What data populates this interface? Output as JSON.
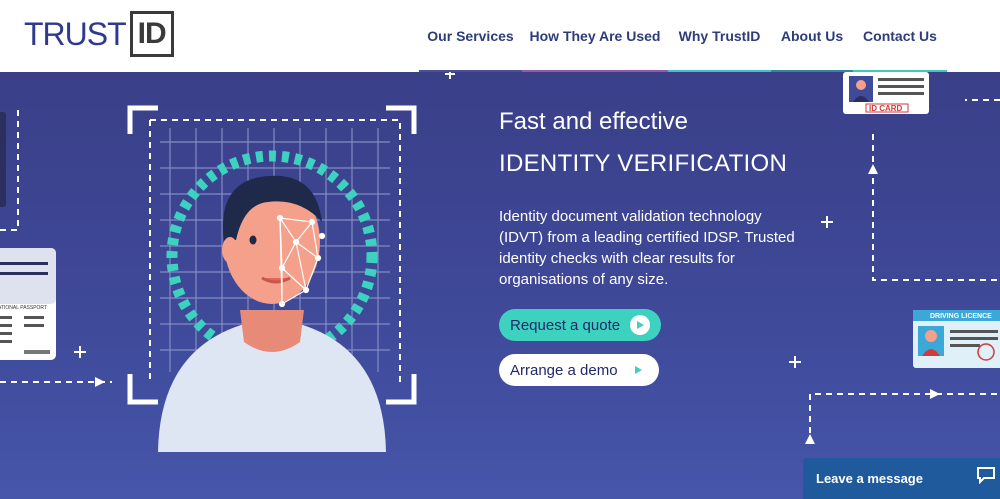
{
  "logo": {
    "trust": "TRUST",
    "id": "ID"
  },
  "nav": [
    {
      "label": "Our Services",
      "color": "#4a4f9a"
    },
    {
      "label": "How They Are Used",
      "color": "#8f5bb0"
    },
    {
      "label": "Why TrustID",
      "color": "#3fc1c9"
    },
    {
      "label": "About Us",
      "color": "#2f8a9e"
    },
    {
      "label": "Contact Us",
      "color": "#3fc9b8"
    }
  ],
  "hero": {
    "tagline": "Fast and effective",
    "headline": "IDENTITY VERIFICATION",
    "description": "Identity document validation technology (IDVT) from a leading certified IDSP. Trusted identity checks with clear results for organisations of any size.",
    "buttons": {
      "quote": "Request a quote",
      "demo": "Arrange a demo"
    }
  },
  "cards": {
    "id_card": "ID CARD",
    "driving_licence": "DRIVING LICENCE",
    "passport": "ATIONAL PASSPORT"
  },
  "chat": {
    "label": "Leave a message"
  },
  "colors": {
    "accent": "#3dd1c0",
    "navy": "#2e3c7a",
    "hero_bg": "#3f4a9a"
  }
}
